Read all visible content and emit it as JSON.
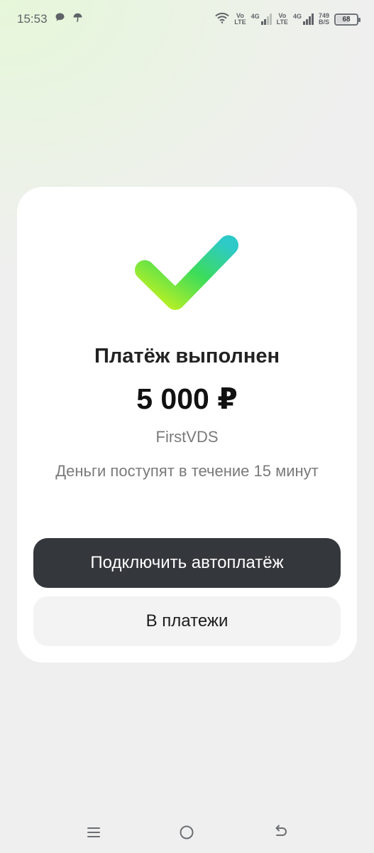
{
  "status_bar": {
    "time": "15:53",
    "net_speed_value": "749",
    "net_speed_unit": "B/S",
    "battery": "68",
    "sim1_volte": "Vo",
    "sim1_lte": "LTE",
    "sim1_gen": "4G",
    "sim2_volte": "Vo",
    "sim2_lte": "LTE",
    "sim2_gen": "4G"
  },
  "result": {
    "title": "Платёж выполнен",
    "amount": "5 000 ₽",
    "merchant": "FirstVDS",
    "note": "Деньги поступят в течение 15 минут"
  },
  "actions": {
    "autopay_label": "Подключить автоплатёж",
    "payments_label": "В платежи"
  },
  "colors": {
    "check_start": "#c8f21e",
    "check_mid": "#3cdc5a",
    "check_end": "#2ec9c9",
    "primary_button": "#34373b"
  },
  "nav": {
    "icons": [
      "menu-icon",
      "home-icon",
      "back-icon"
    ]
  }
}
